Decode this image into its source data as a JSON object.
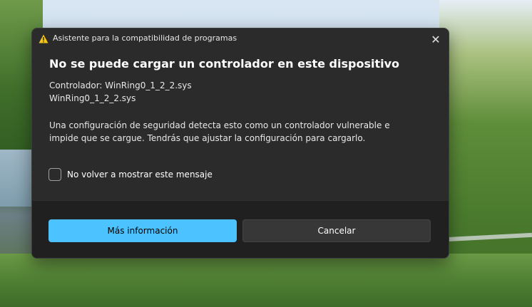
{
  "dialog": {
    "title_bar": "Asistente para la compatibilidad de programas",
    "heading": "No se puede cargar un controlador en este dispositivo",
    "driver_line": "Controlador: WinRing0_1_2_2.sys",
    "file_line": "WinRing0_1_2_2.sys",
    "description": "Una configuración de seguridad detecta esto como un controlador vulnerable e impide que se cargue. Tendrás que ajustar la configuración para cargarlo.",
    "checkbox_label": "No volver a mostrar este mensaje",
    "checkbox_checked": false,
    "primary_button": "Más información",
    "secondary_button": "Cancelar",
    "close_glyph": "✕"
  },
  "colors": {
    "dialog_bg": "#2b2b2b",
    "footer_bg": "#202020",
    "accent": "#4cc2ff",
    "warning": "#f5c518"
  },
  "icons": {
    "title": "warning-icon",
    "close": "close-icon"
  }
}
